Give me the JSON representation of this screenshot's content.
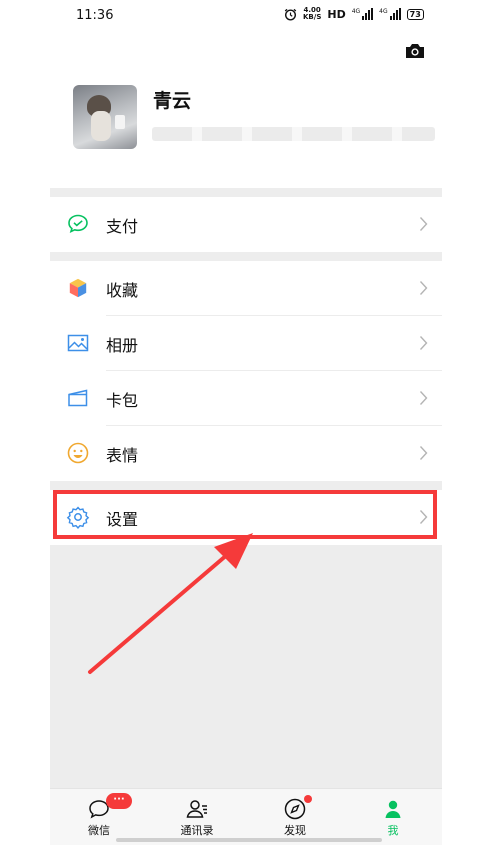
{
  "status_bar": {
    "time": "11:36",
    "speed_value": "4.00",
    "speed_unit": "KB/S",
    "hd_label": "HD",
    "net_1": "4G",
    "net_2": "4G",
    "battery": "73"
  },
  "profile": {
    "name": "青云"
  },
  "menu": {
    "pay": {
      "label": "支付",
      "icon": "wechat-pay-icon"
    },
    "favorites": {
      "label": "收藏",
      "icon": "cube-icon"
    },
    "album": {
      "label": "相册",
      "icon": "photo-icon"
    },
    "cards": {
      "label": "卡包",
      "icon": "card-icon"
    },
    "stickers": {
      "label": "表情",
      "icon": "smile-icon"
    },
    "settings": {
      "label": "设置",
      "icon": "gear-icon"
    }
  },
  "tabs": [
    {
      "label": "微信",
      "badge": "···"
    },
    {
      "label": "通讯录"
    },
    {
      "label": "发现"
    },
    {
      "label": "我"
    }
  ],
  "colors": {
    "accent": "#07c160",
    "annotation": "#f53a3a",
    "separator": "#ededed"
  }
}
